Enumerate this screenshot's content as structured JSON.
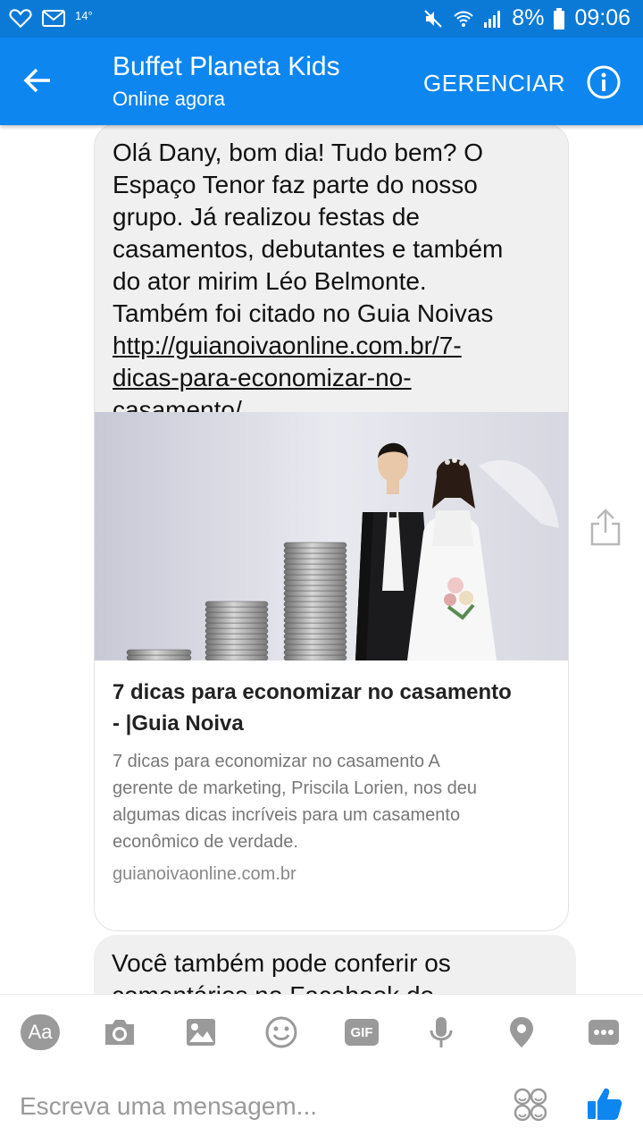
{
  "status_bar": {
    "temperature": "14°",
    "battery": "8%",
    "time": "09:06",
    "icons": [
      "heart-icon",
      "mail-icon",
      "mute-icon",
      "wifi-icon",
      "signal-icon",
      "battery-icon"
    ]
  },
  "header": {
    "title": "Buffet Planeta Kids",
    "subtitle": "Online agora",
    "manage_label": "GERENCIAR",
    "colors": {
      "status_bar": "#0a7ad6",
      "app_bar": "#0d86f0"
    }
  },
  "messages": {
    "first": {
      "lines": [
        "Olá Dany, bom dia! Tudo bem? O",
        "Espaço Tenor faz parte do nosso",
        "grupo. Já realizou festas de",
        "casamentos, debutantes e também",
        "do ator mirim Léo Belmonte.",
        "Também foi citado no Guia Noivas"
      ],
      "link_lines": [
        "http://guianoivaonline.com.br/7-",
        "dicas-para-economizar-no-",
        "casamento/"
      ]
    },
    "link_preview": {
      "title_lines": [
        "7 dicas para economizar no casamento",
        "- |Guia Noiva"
      ],
      "description_lines": [
        "7 dicas para economizar no casamento A",
        "gerente de marketing, Priscila Lorien, nos deu",
        "algumas dicas incríveis para um casamento",
        "econômico de verdade."
      ],
      "domain": "guianoivaonline.com.br"
    },
    "second": {
      "lines": [
        "Você também pode conferir os",
        "comentários no Facebook do"
      ]
    }
  },
  "composer": {
    "placeholder": "Escreva uma mensagem...",
    "tools": [
      "Aa",
      "camera-icon",
      "image-icon",
      "emoji-icon",
      "GIF",
      "microphone-icon",
      "location-icon",
      "more-icon"
    ],
    "accent": "#0d86f0"
  }
}
